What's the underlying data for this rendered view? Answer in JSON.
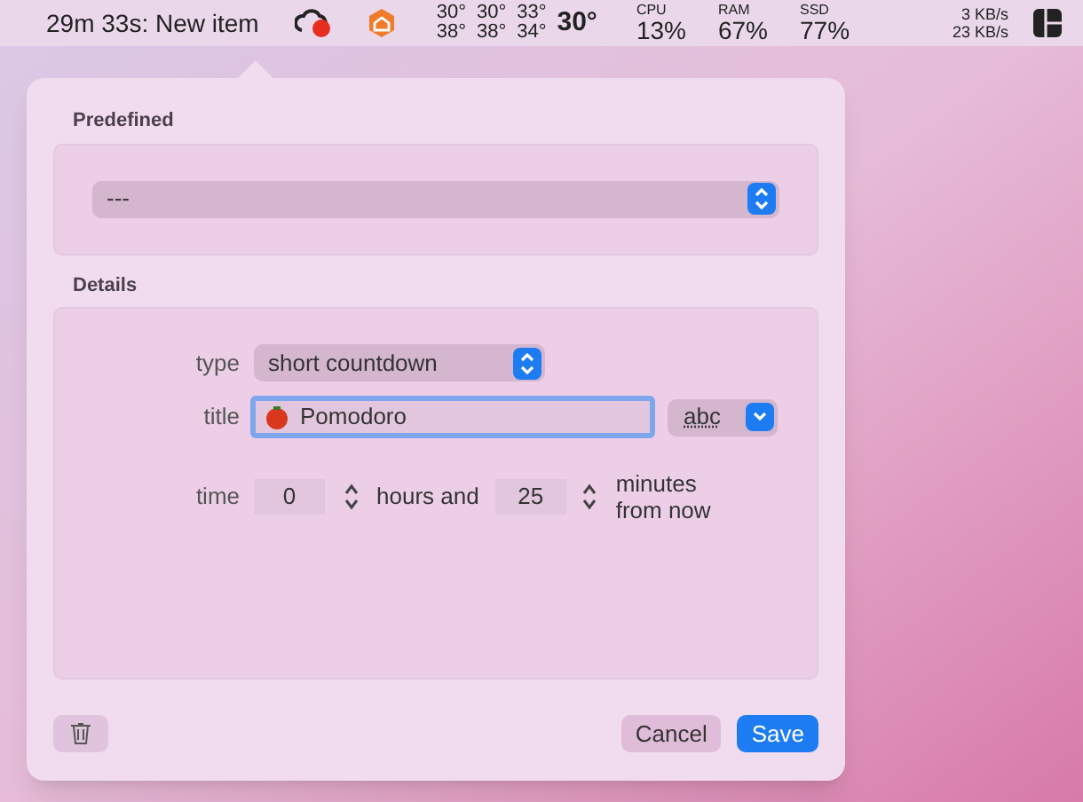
{
  "menu_bar": {
    "timer": "29m 33s: New item",
    "temperatures": [
      {
        "top": "30°",
        "bottom": "38°"
      },
      {
        "top": "30°",
        "bottom": "38°"
      },
      {
        "top": "33°",
        "bottom": "34°"
      }
    ],
    "temperature_main": "30°",
    "meters": [
      {
        "label": "CPU",
        "value": "13%"
      },
      {
        "label": "RAM",
        "value": "67%"
      },
      {
        "label": "SSD",
        "value": "77%"
      }
    ],
    "network": {
      "up": "3 KB/s",
      "down": "23 KB/s"
    }
  },
  "predefined": {
    "heading": "Predefined",
    "value": "---"
  },
  "details": {
    "heading": "Details",
    "type": {
      "label": "type",
      "value": "short countdown"
    },
    "title": {
      "label": "title",
      "value": "Pomodoro",
      "format": "abc"
    },
    "time": {
      "label": "time",
      "hours": "0",
      "hours_label": "hours and",
      "minutes": "25",
      "minutes_label": "minutes from now"
    }
  },
  "buttons": [
    {
      "label": "Cancel",
      "kind": "secondary"
    },
    {
      "label": "Save",
      "kind": "primary"
    }
  ]
}
